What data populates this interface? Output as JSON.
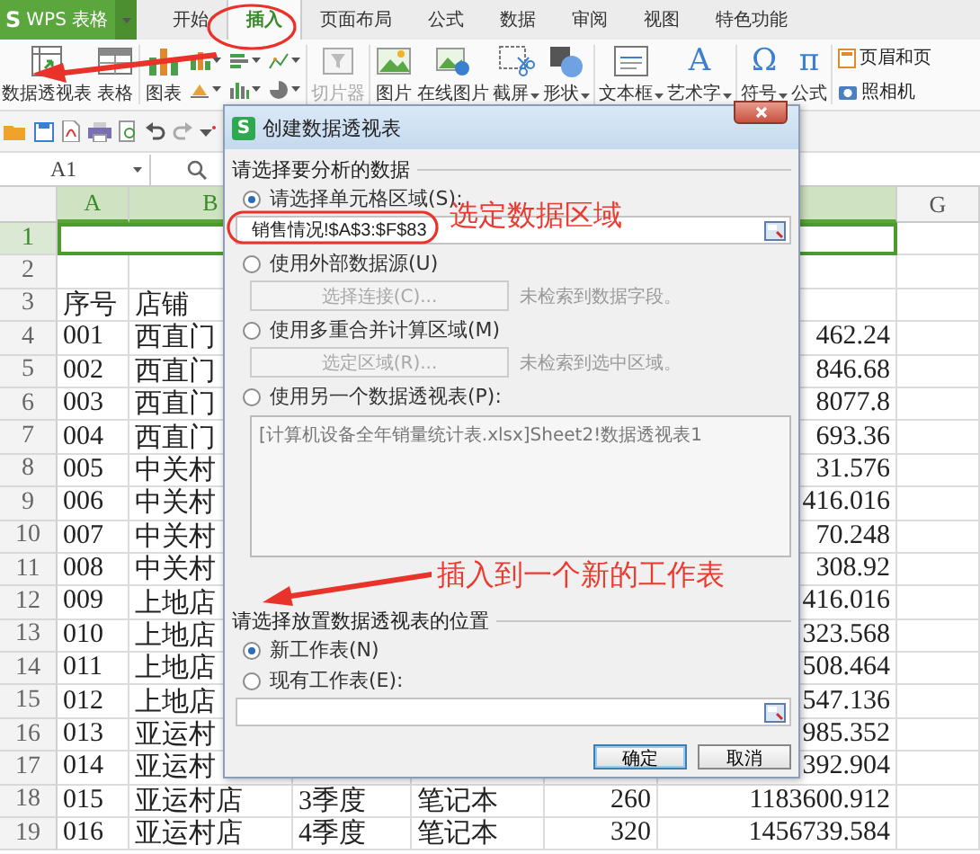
{
  "app_menu": {
    "logo": "S",
    "label": "WPS 表格"
  },
  "tabs": [
    {
      "label": "开始",
      "selected": false
    },
    {
      "label": "插入",
      "selected": true
    },
    {
      "label": "页面布局",
      "selected": false
    },
    {
      "label": "公式",
      "selected": false
    },
    {
      "label": "数据",
      "selected": false
    },
    {
      "label": "审阅",
      "selected": false
    },
    {
      "label": "视图",
      "selected": false
    },
    {
      "label": "特色功能",
      "selected": false
    }
  ],
  "ribbon": {
    "items": [
      {
        "label": "数据透视表",
        "dropdown": false,
        "disabled": false
      },
      {
        "label": "表格",
        "dropdown": false,
        "disabled": false
      },
      {
        "label": "图表",
        "dropdown": false,
        "disabled": false
      },
      {
        "label": "切片器",
        "dropdown": false,
        "disabled": true
      },
      {
        "label": "图片",
        "dropdown": false,
        "disabled": false
      },
      {
        "label": "在线图片",
        "dropdown": false,
        "disabled": false
      },
      {
        "label": "截屏",
        "dropdown": true,
        "disabled": false
      },
      {
        "label": "形状",
        "dropdown": true,
        "disabled": false
      },
      {
        "label": "文本框",
        "dropdown": true,
        "disabled": false
      },
      {
        "label": "艺术字",
        "dropdown": true,
        "disabled": false,
        "glyph": "A"
      },
      {
        "label": "符号",
        "dropdown": true,
        "disabled": false,
        "glyph": "Ω"
      },
      {
        "label": "公式",
        "dropdown": false,
        "disabled": false,
        "glyph": "π"
      }
    ],
    "small_items": [
      {
        "label": "页眉和页"
      },
      {
        "label": "照相机"
      }
    ]
  },
  "name_box": "A1",
  "sheet": {
    "columns": [
      {
        "label": "A",
        "selected": true
      },
      {
        "label": "B",
        "selected": true
      },
      {
        "selected": true
      },
      {
        "label": "G",
        "selected": false
      }
    ],
    "rows": [
      {
        "number": "1",
        "selected": true
      },
      {
        "number": "2",
        "selected": false
      },
      {
        "number": "3",
        "selected": false,
        "cells": [
          "序号",
          "店铺"
        ]
      },
      {
        "number": "4",
        "selected": false,
        "cells": [
          "001",
          "西直门",
          null,
          null,
          null,
          "462.24"
        ]
      },
      {
        "number": "5",
        "selected": false,
        "cells": [
          "002",
          "西直门",
          null,
          null,
          null,
          "846.68"
        ]
      },
      {
        "number": "6",
        "selected": false,
        "cells": [
          "003",
          "西直门",
          null,
          null,
          null,
          "8077.8"
        ]
      },
      {
        "number": "7",
        "selected": false,
        "cells": [
          "004",
          "西直门",
          null,
          null,
          null,
          "693.36"
        ]
      },
      {
        "number": "8",
        "selected": false,
        "cells": [
          "005",
          "中关村",
          null,
          null,
          null,
          "31.576"
        ]
      },
      {
        "number": "9",
        "selected": false,
        "cells": [
          "006",
          "中关村",
          null,
          null,
          null,
          "416.016"
        ]
      },
      {
        "number": "10",
        "selected": false,
        "cells": [
          "007",
          "中关村",
          null,
          null,
          null,
          "70.248"
        ]
      },
      {
        "number": "11",
        "selected": false,
        "cells": [
          "008",
          "中关村",
          null,
          null,
          null,
          "308.92"
        ]
      },
      {
        "number": "12",
        "selected": false,
        "cells": [
          "009",
          "上地店",
          null,
          null,
          null,
          "416.016"
        ]
      },
      {
        "number": "13",
        "selected": false,
        "cells": [
          "010",
          "上地店",
          null,
          null,
          null,
          "323.568"
        ]
      },
      {
        "number": "14",
        "selected": false,
        "cells": [
          "011",
          "上地店",
          null,
          null,
          null,
          "508.464"
        ]
      },
      {
        "number": "15",
        "selected": false,
        "cells": [
          "012",
          "上地店",
          null,
          null,
          null,
          "547.136"
        ]
      },
      {
        "number": "16",
        "selected": false,
        "cells": [
          "013",
          "亚运村",
          null,
          null,
          null,
          "985.352"
        ]
      },
      {
        "number": "17",
        "selected": false,
        "cells": [
          "014",
          "亚运村",
          null,
          null,
          null,
          "392.904"
        ]
      },
      {
        "number": "18",
        "selected": false,
        "cells": [
          "015",
          "亚运村店",
          "3季度",
          "笔记本",
          "260",
          "1183600.912"
        ]
      },
      {
        "number": "19",
        "selected": false,
        "cells": [
          "016",
          "亚运村店",
          "4季度",
          "笔记本",
          "320",
          "1456739.584"
        ]
      }
    ]
  },
  "dialog": {
    "logo": "S",
    "title": "创建数据透视表",
    "source_group": "请选择要分析的数据",
    "source_options": [
      {
        "kind": "range",
        "label": "请选择单元格区域(S):",
        "selected": true,
        "value": "销售情况!$A$3:$F$83"
      },
      {
        "kind": "connection",
        "label": "使用外部数据源(U)",
        "selected": false,
        "button": "选择连接(C)...",
        "note": "未检索到数据字段。"
      },
      {
        "kind": "connection",
        "label": "使用多重合并计算区域(M)",
        "selected": false,
        "button": "选定区域(R)...",
        "note": "未检索到选中区域。"
      },
      {
        "kind": "list",
        "label": "使用另一个数据透视表(P):",
        "selected": false,
        "items": [
          "[计算机设备全年销量统计表.xlsx]Sheet2!数据透视表1"
        ]
      }
    ],
    "location_group": "请选择放置数据透视表的位置",
    "location_options": [
      {
        "label": "新工作表(N)",
        "selected": true
      },
      {
        "label": "现有工作表(E):",
        "selected": false
      }
    ],
    "buttons": [
      {
        "label": "确定",
        "default": true
      },
      {
        "label": "取消",
        "default": false
      }
    ]
  },
  "annotations": [
    {
      "text": "选定数据区域"
    },
    {
      "text": "插入到一个新的工作表"
    }
  ]
}
